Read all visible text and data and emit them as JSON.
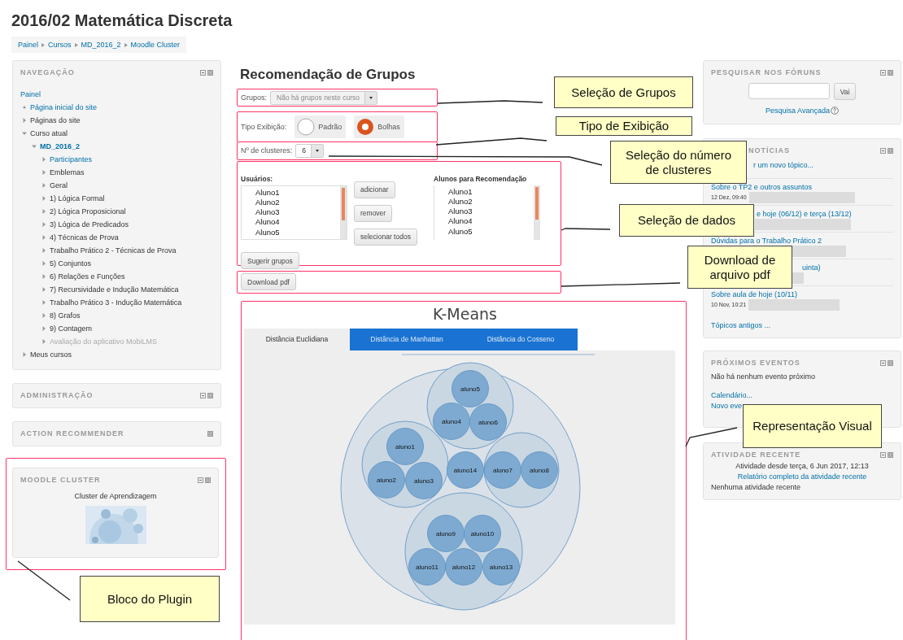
{
  "page_title": "2016/02 Matemática Discreta",
  "breadcrumb": [
    "Painel",
    "Cursos",
    "MD_2016_2",
    "Moodle Cluster"
  ],
  "navigation": {
    "title": "NAVEGAÇÃO",
    "collapsible": true,
    "items": [
      {
        "label": "Painel",
        "kind": "root",
        "link": true
      },
      {
        "label": "Página inicial do site",
        "kind": "leaf",
        "link": true
      },
      {
        "label": "Páginas do site",
        "kind": "branch",
        "link": false,
        "expanded": false
      },
      {
        "label": "Curso atual",
        "kind": "branch",
        "link": false,
        "expanded": true,
        "children": [
          {
            "label": "MD_2016_2",
            "kind": "branch",
            "link": true,
            "current": true,
            "expanded": true,
            "children": [
              {
                "label": "Participantes",
                "kind": "branch",
                "link": true,
                "disabled": false,
                "expanded": false
              },
              {
                "label": "Emblemas",
                "kind": "branch",
                "link": false,
                "disabled": false,
                "expanded": false
              },
              {
                "label": "Geral",
                "kind": "branch",
                "link": false,
                "disabled": false,
                "expanded": false
              },
              {
                "label": "1) Lógica Formal",
                "kind": "branch",
                "link": false,
                "disabled": false,
                "expanded": false
              },
              {
                "label": "2) Lógica Proposicional",
                "kind": "branch",
                "link": false,
                "disabled": false,
                "expanded": false
              },
              {
                "label": "3) Lógica de Predicados",
                "kind": "branch",
                "link": false,
                "disabled": false,
                "expanded": false
              },
              {
                "label": "4) Técnicas de Prova",
                "kind": "branch",
                "link": false,
                "disabled": false,
                "expanded": false
              },
              {
                "label": "Trabalho Prático 2 - Técnicas de Prova",
                "kind": "branch",
                "link": false,
                "disabled": false,
                "expanded": false
              },
              {
                "label": "5) Conjuntos",
                "kind": "branch",
                "link": false,
                "disabled": false,
                "expanded": false
              },
              {
                "label": "6) Relações e Funções",
                "kind": "branch",
                "link": false,
                "disabled": false,
                "expanded": false
              },
              {
                "label": "7) Recursividade e Indução Matemática",
                "kind": "branch",
                "link": false,
                "disabled": false,
                "expanded": false
              },
              {
                "label": "Trabalho Prático 3 - Indução Matemática",
                "kind": "branch",
                "link": false,
                "disabled": false,
                "expanded": false
              },
              {
                "label": "8) Grafos",
                "kind": "branch",
                "link": false,
                "disabled": false,
                "expanded": false
              },
              {
                "label": "9) Contagem",
                "kind": "branch",
                "link": false,
                "disabled": false,
                "expanded": false
              },
              {
                "label": "Avaliação do aplicativo MobiLMS",
                "kind": "branch",
                "link": false,
                "disabled": true,
                "expanded": false
              }
            ]
          }
        ]
      },
      {
        "label": "Meus cursos",
        "kind": "branch",
        "link": false,
        "expanded": false
      }
    ]
  },
  "left_blocks": [
    {
      "title": "ADMINISTRAÇÃO",
      "collapsible": true,
      "highlighted": false
    },
    {
      "title": "ACTION RECOMMENDER",
      "collapsible": false,
      "highlighted": false
    },
    {
      "title": "MOODLE CLUSTER",
      "collapsible": true,
      "highlighted": true,
      "caption": "Cluster de Aprendizagem"
    }
  ],
  "recommendation": {
    "title": "Recomendação de Grupos",
    "groups": {
      "label": "Grupos:",
      "value": "Não há grupos neste curso",
      "disabled": true
    },
    "display_type": {
      "label": "Tipo Exibição:",
      "options": [
        {
          "label": "Padrão",
          "selected": false
        },
        {
          "label": "Bolhas",
          "selected": true
        }
      ]
    },
    "clusters": {
      "label": "Nº de clusteres:",
      "value": "6"
    },
    "users": {
      "label": "Usuários:",
      "items": [
        "Aluno1",
        "Aluno2",
        "Aluno3",
        "Aluno4",
        "Aluno5"
      ]
    },
    "actions": [
      "adicionar",
      "remover",
      "selecionar todos"
    ],
    "recommended": {
      "label": "Alunos para Recomendação",
      "items": [
        "Aluno1",
        "Aluno2",
        "Aluno3",
        "Aluno4",
        "Aluno5"
      ]
    },
    "suggest_button": "Sugerir grupos",
    "download_button": "Download pdf"
  },
  "kmeans": {
    "title": "K-Means",
    "tabs": [
      {
        "label": "Distância Euclidiana",
        "selected": true
      },
      {
        "label": "Distância de Manhattan",
        "selected": false
      },
      {
        "label": "Distância do Cosseno",
        "selected": false
      }
    ],
    "clusters": [
      {
        "kind": "group",
        "members": [
          "aluno5",
          "aluno4",
          "aluno6"
        ]
      },
      {
        "kind": "group",
        "members": [
          "aluno1",
          "aluno2",
          "aluno3"
        ]
      },
      {
        "kind": "single",
        "members": [
          "aluno14"
        ]
      },
      {
        "kind": "group",
        "members": [
          "aluno7",
          "aluno8"
        ]
      },
      {
        "kind": "group",
        "members": [
          "aluno9",
          "aluno10",
          "aluno11",
          "aluno12",
          "aluno13"
        ]
      }
    ]
  },
  "forum_search": {
    "title": "PESQUISAR NOS FÓRUNS",
    "button": "Vai",
    "advanced_link": "Pesquisa Avançada"
  },
  "news": {
    "title": "NOTÍCIAS",
    "add_link": "r um novo tópico...",
    "posts": [
      {
        "title": "Sobre o TP2 e outros assuntos",
        "date": "12 Dez, 09:40"
      },
      {
        "title": "e hoje (06/12) e terça (13/12)"
      },
      {
        "title": "Dúvidas para o Trabalho Prático 2"
      },
      {
        "title": "uinta)"
      },
      {
        "title": "Sobre aula de hoje (10/11)",
        "date": "10 Nov, 10:21"
      }
    ],
    "older_link": "Tópicos antigos ..."
  },
  "events": {
    "title": "PRÓXIMOS EVENTOS",
    "message": "Não há nenhum evento próximo",
    "links": [
      "Calendário...",
      "Novo eve"
    ]
  },
  "recent": {
    "title": "ATIVIDADE RECENTE",
    "since": "Atividade desde terça, 6 Jun 2017, 12:13",
    "report_link": "Relatório completo da atividade recente",
    "message": "Nenhuma atividade recente"
  },
  "callouts": [
    "Seleção de Grupos",
    "Tipo de Exibição",
    "Seleção do número de clusteres",
    "Seleção de dados",
    "Download de arquivo pdf",
    "Representação Visual",
    "Bloco do Plugin"
  ]
}
